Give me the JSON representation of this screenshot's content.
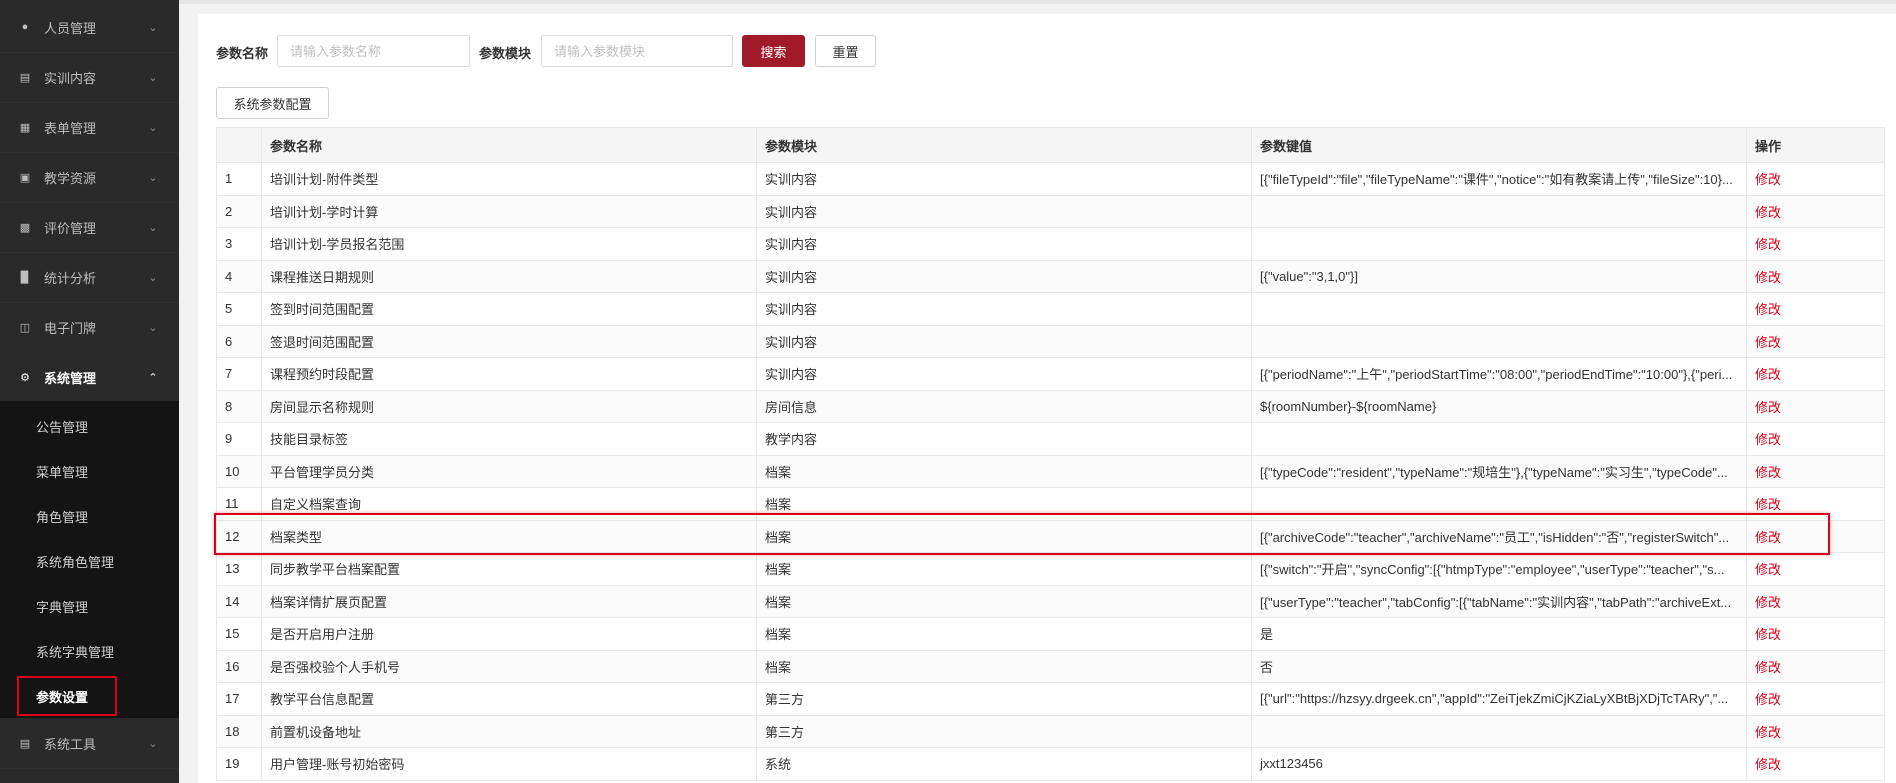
{
  "sidebar": {
    "menu": [
      {
        "label": "人员管理",
        "icon": "user-icon"
      },
      {
        "label": "实训内容",
        "icon": "document-icon"
      },
      {
        "label": "表单管理",
        "icon": "form-icon"
      },
      {
        "label": "教学资源",
        "icon": "book-icon"
      },
      {
        "label": "评价管理",
        "icon": "rating-icon"
      },
      {
        "label": "统计分析",
        "icon": "bar-chart-icon"
      },
      {
        "label": "电子门牌",
        "icon": "monitor-icon"
      },
      {
        "label": "系统管理",
        "icon": "gear-icon"
      },
      {
        "label": "系统工具",
        "icon": "toolbox-icon"
      }
    ],
    "submenu": [
      {
        "label": "公告管理"
      },
      {
        "label": "菜单管理"
      },
      {
        "label": "角色管理"
      },
      {
        "label": "系统角色管理"
      },
      {
        "label": "字典管理"
      },
      {
        "label": "系统字典管理"
      },
      {
        "label": "参数设置"
      }
    ]
  },
  "filters": {
    "name_label": "参数名称",
    "name_placeholder": "请输入参数名称",
    "module_label": "参数模块",
    "module_placeholder": "请输入参数模块",
    "search_label": "搜索",
    "reset_label": "重置",
    "config_button_label": "系统参数配置"
  },
  "table": {
    "columns": [
      "",
      "参数名称",
      "参数模块",
      "参数键值",
      "操作"
    ],
    "rows": [
      {
        "no": "1",
        "name": "培训计划-附件类型",
        "module": "实训内容",
        "value": "[{\"fileTypeId\":\"file\",\"fileTypeName\":\"课件\",\"notice\":\"如有教案请上传\",\"fileSize\":10}...",
        "action": "修改"
      },
      {
        "no": "2",
        "name": "培训计划-学时计算",
        "module": "实训内容",
        "value": "",
        "action": "修改"
      },
      {
        "no": "3",
        "name": "培训计划-学员报名范围",
        "module": "实训内容",
        "value": "",
        "action": "修改"
      },
      {
        "no": "4",
        "name": "课程推送日期规则",
        "module": "实训内容",
        "value": "[{\"value\":\"3,1,0\"}]",
        "action": "修改"
      },
      {
        "no": "5",
        "name": "签到时间范围配置",
        "module": "实训内容",
        "value": "",
        "action": "修改"
      },
      {
        "no": "6",
        "name": "签退时间范围配置",
        "module": "实训内容",
        "value": "",
        "action": "修改"
      },
      {
        "no": "7",
        "name": "课程预约时段配置",
        "module": "实训内容",
        "value": "[{\"periodName\":\"上午\",\"periodStartTime\":\"08:00\",\"periodEndTime\":\"10:00\"},{\"peri...",
        "action": "修改"
      },
      {
        "no": "8",
        "name": "房间显示名称规则",
        "module": "房间信息",
        "value": "${roomNumber}-${roomName}",
        "action": "修改"
      },
      {
        "no": "9",
        "name": "技能目录标签",
        "module": "教学内容",
        "value": "",
        "action": "修改"
      },
      {
        "no": "10",
        "name": "平台管理学员分类",
        "module": "档案",
        "value": "[{\"typeCode\":\"resident\",\"typeName\":\"规培生\"},{\"typeName\":\"实习生\",\"typeCode\"...",
        "action": "修改"
      },
      {
        "no": "11",
        "name": "自定义档案查询",
        "module": "档案",
        "value": "",
        "action": "修改"
      },
      {
        "no": "12",
        "name": "档案类型",
        "module": "档案",
        "value": "[{\"archiveCode\":\"teacher\",\"archiveName\":\"员工\",\"isHidden\":\"否\",\"registerSwitch\"...",
        "action": "修改"
      },
      {
        "no": "13",
        "name": "同步教学平台档案配置",
        "module": "档案",
        "value": "[{\"switch\":\"开启\",\"syncConfig\":[{\"htmpType\":\"employee\",\"userType\":\"teacher\",\"s...",
        "action": "修改"
      },
      {
        "no": "14",
        "name": "档案详情扩展页配置",
        "module": "档案",
        "value": "[{\"userType\":\"teacher\",\"tabConfig\":[{\"tabName\":\"实训内容\",\"tabPath\":\"archiveExt...",
        "action": "修改"
      },
      {
        "no": "15",
        "name": "是否开启用户注册",
        "module": "档案",
        "value": "是",
        "action": "修改"
      },
      {
        "no": "16",
        "name": "是否强校验个人手机号",
        "module": "档案",
        "value": "否",
        "action": "修改"
      },
      {
        "no": "17",
        "name": "教学平台信息配置",
        "module": "第三方",
        "value": "[{\"url\":\"https://hzsyy.drgeek.cn\",\"appId\":\"ZeiTjekZmiCjKZiaLyXBtBjXDjTcTARy\",\"...",
        "action": "修改"
      },
      {
        "no": "18",
        "name": "前置机设备地址",
        "module": "第三方",
        "value": "",
        "action": "修改"
      },
      {
        "no": "19",
        "name": "用户管理-账号初始密码",
        "module": "系统",
        "value": "jxxt123456",
        "action": "修改"
      }
    ]
  },
  "colors": {
    "accent": "#a01a2a",
    "link": "#d9001b",
    "sidebar_bg": "#2a2a2a",
    "submenu_bg": "#141414"
  }
}
